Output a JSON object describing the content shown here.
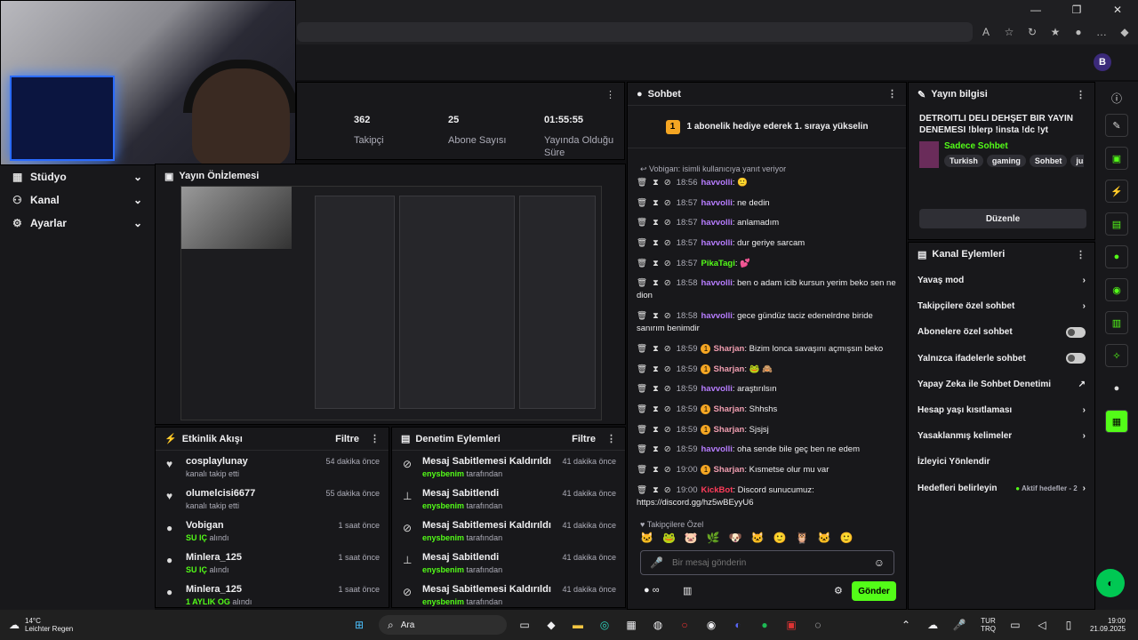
{
  "window": {
    "minimize": "—",
    "maximize": "❐",
    "close": "✕"
  },
  "sidebar": {
    "items": [
      {
        "label": "Stüdyo"
      },
      {
        "label": "Kanal"
      },
      {
        "label": "Ayarlar"
      }
    ]
  },
  "stats": [
    {
      "value": "362",
      "label": "Takipçi"
    },
    {
      "value": "25",
      "label": "Abone Sayısı"
    },
    {
      "value": "01:55:55",
      "label": "Yayında Olduğu Süre"
    }
  ],
  "preview": {
    "title": "Yayın Önİzlemesi"
  },
  "activity": {
    "title": "Etkinlik Akışı",
    "filter": "Filtre",
    "items": [
      {
        "name": "cosplaylunay",
        "sub": "kanalı takip etti",
        "time": "54 dakika önce",
        "icon": "♥"
      },
      {
        "name": "olumelcisi6677",
        "sub": "kanalı takip etti",
        "time": "55 dakika önce",
        "icon": "♥"
      },
      {
        "name": "Vobigan",
        "subb": "SU IÇ",
        "sub": "alındı",
        "time": "1 saat önce",
        "icon": "●"
      },
      {
        "name": "Minlera_125",
        "subb": "SU IÇ",
        "sub": "alındı",
        "time": "1 saat önce",
        "icon": "●"
      },
      {
        "name": "Minlera_125",
        "subb": "1 AYLIK OG",
        "sub": "alındı",
        "time": "1 saat önce",
        "icon": "●"
      }
    ]
  },
  "mod": {
    "title": "Denetim Eylemleri",
    "filter": "Filtre",
    "items": [
      {
        "name": "Mesaj Sabitlemesi Kaldırıldı",
        "subb": "enysbenim",
        "sub": "tarafından",
        "time": "41 dakika önce",
        "icon": "⊘"
      },
      {
        "name": "Mesaj Sabitlendi",
        "subb": "enysbenim",
        "sub": "tarafından",
        "time": "41 dakika önce",
        "icon": "⊥"
      },
      {
        "name": "Mesaj Sabitlemesi Kaldırıldı",
        "subb": "enysbenim",
        "sub": "tarafından",
        "time": "41 dakika önce",
        "icon": "⊘"
      },
      {
        "name": "Mesaj Sabitlendi",
        "subb": "enysbenim",
        "sub": "tarafından",
        "time": "41 dakika önce",
        "icon": "⊥"
      },
      {
        "name": "Mesaj Sabitlemesi Kaldırıldı",
        "subb": "enysbenim",
        "sub": "tarafından",
        "time": "41 dakika önce",
        "icon": "⊘"
      }
    ]
  },
  "chat": {
    "title": "Sohbet",
    "pinned_badge": "1",
    "pinned": "1 abonelik hediye ederek 1. sıraya yükselin",
    "reply_note_user": "Vobigan:",
    "reply_note": "isimli kullanıcıya yanıt veriyor",
    "messages": [
      {
        "time": "18:56",
        "user": "havvolli",
        "color": "#b77dff",
        "text": "🙂",
        "sub": false
      },
      {
        "time": "18:57",
        "user": "havvolli",
        "color": "#b77dff",
        "text": "ne dedin",
        "sub": false
      },
      {
        "time": "18:57",
        "user": "havvolli",
        "color": "#b77dff",
        "text": "anlamadım",
        "sub": false
      },
      {
        "time": "18:57",
        "user": "havvolli",
        "color": "#b77dff",
        "text": "dur geriye sarcam",
        "sub": false
      },
      {
        "time": "18:57",
        "user": "PikaTagi",
        "color": "#53fc18",
        "text": "💕",
        "sub": false
      },
      {
        "time": "18:58",
        "user": "havvolli",
        "color": "#b77dff",
        "text": "ben o adam icib kursun yerim beko sen ne dion",
        "sub": false
      },
      {
        "time": "18:58",
        "user": "havvolli",
        "color": "#b77dff",
        "text": "gece gündüz taciz edenelrdne biride sanırım benimdir",
        "sub": false
      },
      {
        "time": "18:59",
        "user": "Sharjan",
        "color": "#f09db0",
        "text": "Bizim lonca savaşını açmışsın beko",
        "sub": true
      },
      {
        "time": "18:59",
        "user": "Sharjan",
        "color": "#f09db0",
        "text": "🐸 🙈",
        "sub": true
      },
      {
        "time": "18:59",
        "user": "havvolli",
        "color": "#b77dff",
        "text": "araştırılsın",
        "sub": false
      },
      {
        "time": "18:59",
        "user": "Sharjan",
        "color": "#f09db0",
        "text": "Shhshs",
        "sub": true
      },
      {
        "time": "18:59",
        "user": "Sharjan",
        "color": "#f09db0",
        "text": "Sjsjsj",
        "sub": true
      },
      {
        "time": "18:59",
        "user": "havvolli",
        "color": "#b77dff",
        "text": "oha sende bile geç ben ne edem",
        "sub": false
      },
      {
        "time": "19:00",
        "user": "Sharjan",
        "color": "#f09db0",
        "text": "Kısmetse olur mu var",
        "sub": true
      },
      {
        "time": "19:00",
        "user": "KickBot",
        "color": "#ff3c5a",
        "text": "Discord sunucumuz: https://discord.gg/hz5wBEyyU6",
        "sub": false
      }
    ],
    "followers_only": "Takipçilere Özel",
    "input_placeholder": "Bir mesaj gönderin",
    "send": "Gönder",
    "points": "∞"
  },
  "streaminfo": {
    "title": "Yayın bilgisi",
    "stream_title": "DETROITLI DELI DEHŞET BIR YAYIN DENEMESI !blerp !insta !dc !yt",
    "category": "Sadece Sohbet",
    "tags": [
      "Turkish",
      "gaming",
      "Sohbet",
      "justch"
    ],
    "edit": "Düzenle"
  },
  "actions": {
    "title": "Kanal Eylemleri",
    "items": [
      {
        "label": "Yavaş mod",
        "ctrl": "chevron"
      },
      {
        "label": "Takipçilere özel sohbet",
        "ctrl": "chevron"
      },
      {
        "label": "Abonelere özel sohbet",
        "ctrl": "toggle"
      },
      {
        "label": "Yalnızca ifadelerle sohbet",
        "ctrl": "toggle"
      },
      {
        "label": "Yapay Zeka ile Sohbet Denetimi",
        "ctrl": "ext"
      },
      {
        "label": "Hesap yaşı kısıtlaması",
        "ctrl": "chevron"
      },
      {
        "label": "Yasaklanmış kelimeler",
        "ctrl": "chevron"
      },
      {
        "label": "İzleyici Yönlendir",
        "ctrl": "none"
      },
      {
        "label": "Hedefleri belirleyin",
        "ctrl": "goal"
      }
    ],
    "goal_status": "Aktif hedefler - 2"
  },
  "taskbar": {
    "temp": "14°C",
    "weather": "Leichter Regen",
    "search": "Ara",
    "lang1": "TUR",
    "lang2": "TRQ",
    "time": "19:00",
    "date": "21.09.2025"
  },
  "colors": {
    "accent": "#53fc18",
    "bg": "#0e0e10",
    "panel": "#18181b",
    "purple": "#b77dff"
  }
}
